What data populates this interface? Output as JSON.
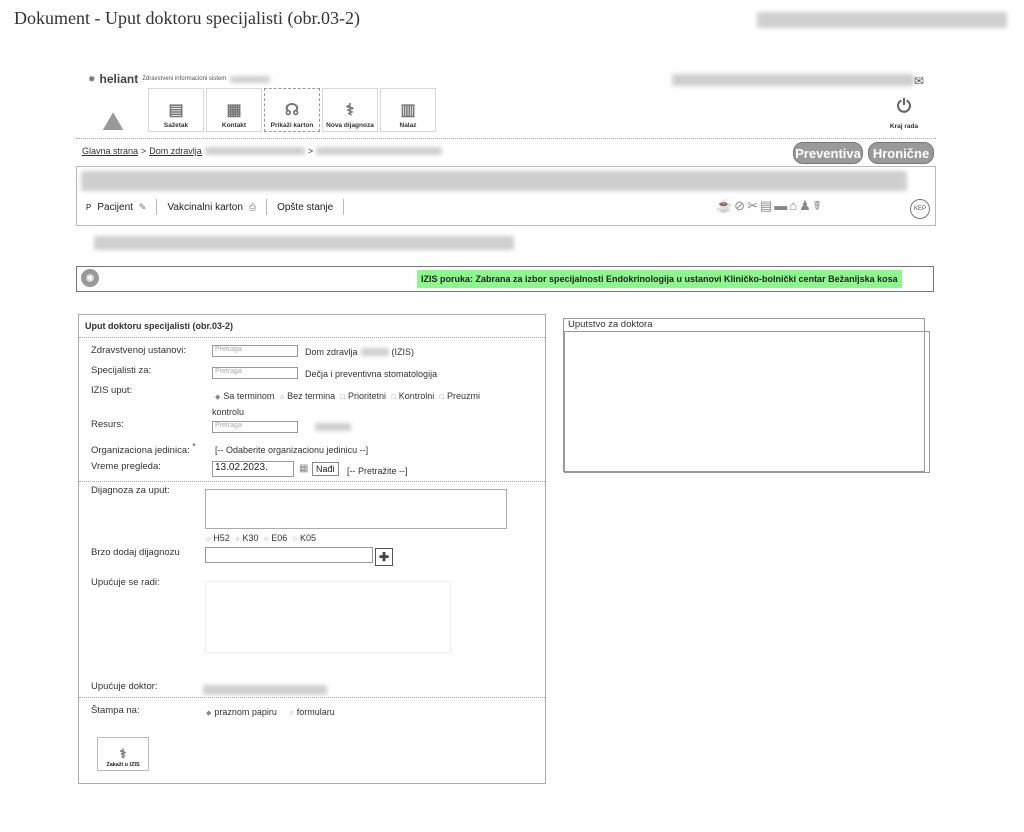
{
  "document_title": "Dokument - Uput doktoru specijalisti (obr.03-2)",
  "app": {
    "logo": "heliant",
    "subtitle": "Zdravstveni informacioni sistem",
    "toolbar": [
      {
        "label": "Sažetak",
        "icon": "summary-icon"
      },
      {
        "label": "Kontakt",
        "icon": "contact-icon"
      },
      {
        "label": "Prikaži karton",
        "icon": "chart-icon"
      },
      {
        "label": "Nova dijagnoza",
        "icon": "diagnosis-icon"
      },
      {
        "label": "Nalaz",
        "icon": "finding-icon"
      }
    ],
    "exit_label": "Kraj rada"
  },
  "breadcrumb": {
    "home": "Glavna strana",
    "sep": ">",
    "facility": "Dom zdravlja"
  },
  "buttons": {
    "preventiva": "Preventiva",
    "hronicne": "Hronične"
  },
  "patient_tabs": [
    "Pacijent",
    "Vakcinalni karton",
    "Opšte stanje"
  ],
  "message": "IZIS poruka: Zabrana za izbor specijalnosti Endokrinologija u ustanovi Kliničko-bolnički centar Bežanijska kosa",
  "form": {
    "title": "Uput doktoru specijalisti (obr.03-2)",
    "ustanova_label": "Zdravstvenoj ustanovi:",
    "search_placeholder": "Pretraga",
    "ustanova_value": "Dom zdravlja",
    "ustanova_suffix": "(IZIS)",
    "specijalisti_label": "Specijalisti za:",
    "specijalisti_value": "Dečja i preventivna stomatologija",
    "izis_label": "IZIS uput:",
    "izis_options": [
      "Sa terminom",
      "Bez termina",
      "Prioritetni",
      "Kontrolni",
      "Preuzmi kontrolu"
    ],
    "resurs_label": "Resurs:",
    "org_label": "Organizaciona jedinica:",
    "org_required": "*",
    "org_value": "[-- Odaberite organizacionu jedinicu --]",
    "vreme_label": "Vreme pregleda:",
    "vreme_value": "13.02.2023.",
    "nadji": "Nađi",
    "pretrazite": "[-- Pretražite --]",
    "dijagnoza_label": "Dijagnoza za uput:",
    "diag_codes": [
      "H52",
      "K30",
      "E06",
      "K05"
    ],
    "brzo_label": "Brzo dodaj dijagnozu",
    "upucuje_label": "Upućuje se radi:",
    "doktor_label": "Upućuje doktor:",
    "stampa_label": "Štampa na:",
    "stampa_options": [
      "praznom papiru",
      "formularu"
    ],
    "zakazi": "Zakaži u IZIS"
  },
  "instructions_title": "Uputstvo za doktora"
}
